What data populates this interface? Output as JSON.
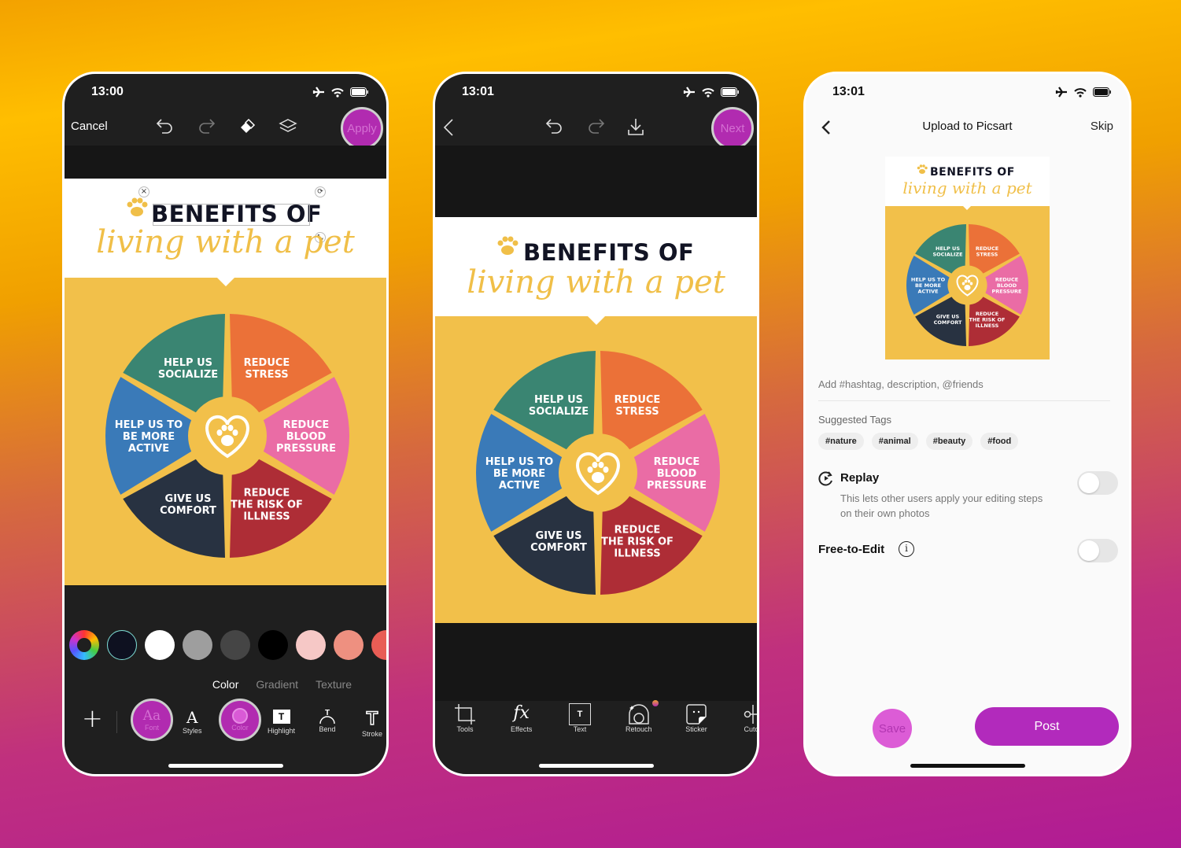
{
  "poster": {
    "title": "BENEFITS OF",
    "subtitle": "living with a pet",
    "segments": [
      {
        "label": [
          "HELP US",
          "SOCIALIZE"
        ],
        "color": "#3a8572"
      },
      {
        "label": [
          "REDUCE",
          "STRESS"
        ],
        "color": "#eb7138"
      },
      {
        "label": [
          "REDUCE",
          "BLOOD",
          "PRESSURE"
        ],
        "color": "#ea6ca5"
      },
      {
        "label": [
          "REDUCE",
          "THE RISK OF",
          "ILLNESS"
        ],
        "color": "#ae2d36"
      },
      {
        "label": [
          "GIVE US",
          "COMFORT"
        ],
        "color": "#283241"
      },
      {
        "label": [
          "HELP US TO",
          "BE MORE",
          "ACTIVE"
        ],
        "color": "#3a7ab8"
      }
    ]
  },
  "phone1": {
    "time": "13:00",
    "cancel_label": "Cancel",
    "apply_label": "Apply",
    "swatches": [
      "#0e1120",
      "#ffffff",
      "#9e9e9e",
      "#454545",
      "#000000",
      "#f6c8c6",
      "#ee9080",
      "#e85d55",
      "#e8343c"
    ],
    "subtabs": [
      "Color",
      "Gradient",
      "Texture"
    ],
    "tools": [
      {
        "label": "Font",
        "icon": "font-icon"
      },
      {
        "label": "Styles",
        "icon": "styles-icon"
      },
      {
        "label": "Color",
        "icon": "color-icon"
      },
      {
        "label": "Highlight",
        "icon": "highlight-icon"
      },
      {
        "label": "Bend",
        "icon": "bend-icon"
      },
      {
        "label": "Stroke",
        "icon": "stroke-icon"
      }
    ]
  },
  "phone2": {
    "time": "13:01",
    "next_label": "Next",
    "tools": [
      {
        "label": "Tools"
      },
      {
        "label": "Effects"
      },
      {
        "label": "Text"
      },
      {
        "label": "Retouch"
      },
      {
        "label": "Sticker"
      },
      {
        "label": "Cuto"
      }
    ]
  },
  "phone3": {
    "time": "13:01",
    "title": "Upload to Picsart",
    "skip_label": "Skip",
    "description_placeholder": "Add #hashtag, description, @friends",
    "suggested_tags_label": "Suggested Tags",
    "tags": [
      "#nature",
      "#animal",
      "#beauty",
      "#food"
    ],
    "replay": {
      "label": "Replay",
      "description_line1": "This lets other users apply your editing steps",
      "description_line2": "on their own photos",
      "enabled": false
    },
    "free_to_edit": {
      "label": "Free-to-Edit",
      "enabled": false
    },
    "save_label": "Save",
    "post_label": "Post"
  },
  "colors": {
    "accent": "#b12bb0",
    "poster_yellow": "#f2c04a"
  }
}
